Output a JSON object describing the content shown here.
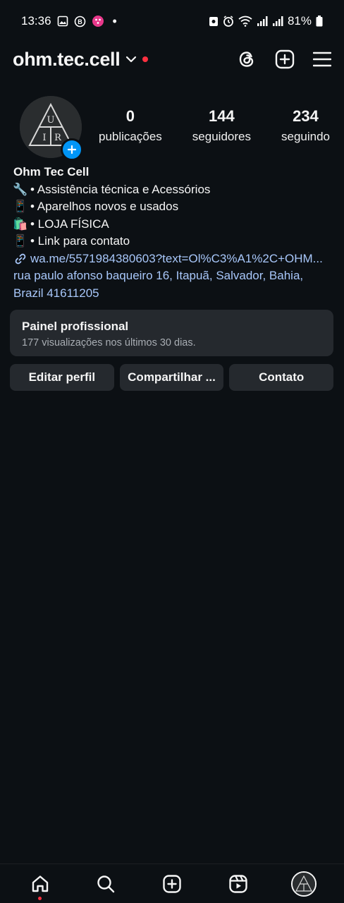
{
  "status_bar": {
    "time": "13:36",
    "battery": "81%",
    "dot": "•"
  },
  "header": {
    "username": "ohm.tec.cell",
    "icons": [
      "threads-icon",
      "plus-square-icon",
      "menu-icon"
    ]
  },
  "profile": {
    "avatar_letters": [
      "U",
      "I",
      "R"
    ],
    "stats": [
      {
        "value": "0",
        "label": "publicações"
      },
      {
        "value": "144",
        "label": "seguidores"
      },
      {
        "value": "234",
        "label": "seguindo"
      }
    ],
    "name": "Ohm Tec Cell",
    "bio_lines": [
      {
        "emoji": "🔧",
        "text": "• Assistência técnica e Acessórios"
      },
      {
        "emoji": "📱",
        "text": "• Aparelhos novos e usados"
      },
      {
        "emoji": "🛍️",
        "text": "• LOJA FÍSICA"
      },
      {
        "emoji": "📱",
        "text": "• Link para contato"
      }
    ],
    "link": "wa.me/5571984380603?text=Ol%C3%A1%2C+OHM...",
    "address": "rua paulo afonso baqueiro 16, Itapuã, Salvador, Bahia, Brazil 41611205"
  },
  "dashboard": {
    "title": "Painel profissional",
    "subtitle": "177 visualizações nos últimos 30 dias."
  },
  "buttons": {
    "edit": "Editar perfil",
    "share": "Compartilhar ...",
    "contact": "Contato"
  },
  "bottom_nav": [
    "home-icon",
    "search-icon",
    "create-icon",
    "reels-icon",
    "profile-avatar"
  ],
  "colors": {
    "background": "#0c1014",
    "card": "#25292e",
    "link": "#a8c7fa",
    "accent": "#0095f6",
    "notification": "#ff3040"
  }
}
